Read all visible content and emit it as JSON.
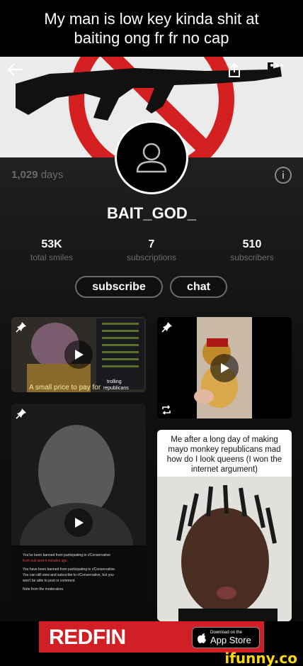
{
  "caption": "My man is low key kinda shit at baiting ong fr fr no cap",
  "profile": {
    "days_count": "1,029",
    "days_label": "days",
    "username": "BAIT_GOD_",
    "stats": [
      {
        "value": "53K",
        "label": "total smiles"
      },
      {
        "value": "7",
        "label": "subscriptions"
      },
      {
        "value": "510",
        "label": "subscribers"
      }
    ],
    "subscribe_label": "subscribe",
    "chat_label": "chat",
    "info_symbol": "i"
  },
  "posts": {
    "thanos": {
      "main_text": "A small price to pay for",
      "small_text": "trolling",
      "small_text2": "republicans"
    },
    "mayo": {
      "caption": "Me after a long day of making mayo monkey republicans mad how do I look queens (I won the internet argument)"
    },
    "banned": {
      "line1": "You've been banned from participating in r/Conservative",
      "line2": "from null sent 4 minutes ago",
      "line3": "You have been banned from participating in r/Conservative.",
      "line4": "You can still view and subscribe to r/Conservative, but you",
      "line5": "won't be able to post or comment.",
      "line6": "Note from the moderators:"
    }
  },
  "ad": {
    "brand": "REDFIN",
    "store_small": "Download on the",
    "store_big": "App Store"
  },
  "watermark": "ifunny.co",
  "icons": [
    "back-arrow-icon",
    "share-icon",
    "more-icon",
    "avatar-placeholder-icon",
    "info-icon",
    "pin-icon",
    "play-icon",
    "repost-icon",
    "apple-icon"
  ]
}
